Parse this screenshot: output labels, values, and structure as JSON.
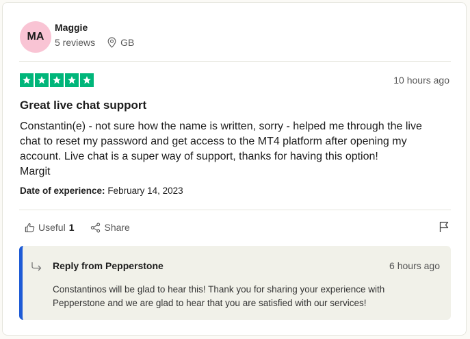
{
  "reviewer": {
    "initials": "MA",
    "name": "Maggie",
    "reviews_count": "5 reviews",
    "country": "GB",
    "avatar_color": "#f9c4d4"
  },
  "review": {
    "rating": 5,
    "max_rating": 5,
    "star_color": "#00b67a",
    "time_ago": "10 hours ago",
    "title": "Great live chat support",
    "body_lines": [
      "Constantin(e) - not sure how the name is written, sorry - helped me through the live",
      "chat to reset my password and get access to the MT4 platform after opening my",
      "account. Live chat is a super way of support, thanks for having this option!",
      "Margit"
    ],
    "date_label": "Date of experience:",
    "date_value": "February 14, 2023"
  },
  "actions": {
    "useful_label": "Useful",
    "useful_count": "1",
    "share_label": "Share",
    "icons": [
      "thumbs-up-icon",
      "share-icon",
      "flag-icon"
    ]
  },
  "reply": {
    "from": "Reply from Pepperstone",
    "time_ago": "6 hours ago",
    "text_lines": [
      "Constantinos will be glad to hear this! Thank you for sharing your experience with",
      "Pepperstone and we are glad to hear that you are satisfied with our services!"
    ],
    "accent_color": "#1e5bd6"
  }
}
